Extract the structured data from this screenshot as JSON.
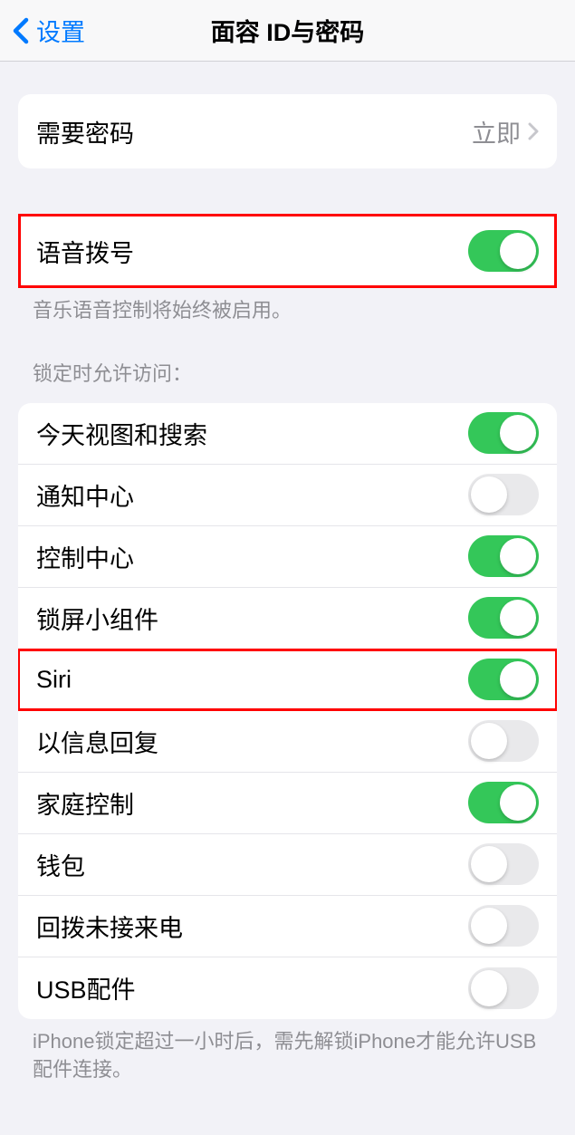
{
  "header": {
    "back_label": "设置",
    "title": "面容 ID与密码"
  },
  "require_passcode": {
    "label": "需要密码",
    "value": "立即"
  },
  "voice_dial": {
    "label": "语音拨号",
    "enabled": true,
    "footer": "音乐语音控制将始终被启用。"
  },
  "lock_section": {
    "header": "锁定时允许访问：",
    "items": [
      {
        "label": "今天视图和搜索",
        "enabled": true
      },
      {
        "label": "通知中心",
        "enabled": false
      },
      {
        "label": "控制中心",
        "enabled": true
      },
      {
        "label": "锁屏小组件",
        "enabled": true
      },
      {
        "label": "Siri",
        "enabled": true
      },
      {
        "label": "以信息回复",
        "enabled": false
      },
      {
        "label": "家庭控制",
        "enabled": true
      },
      {
        "label": "钱包",
        "enabled": false
      },
      {
        "label": "回拨未接来电",
        "enabled": false
      },
      {
        "label": "USB配件",
        "enabled": false
      }
    ],
    "footer": "iPhone锁定超过一小时后，需先解锁iPhone才能允许USB配件连接。"
  }
}
